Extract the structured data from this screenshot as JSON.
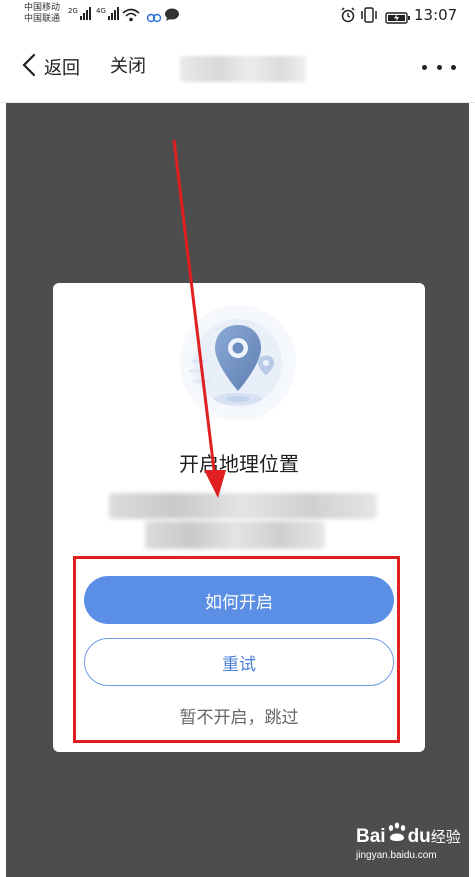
{
  "status_bar": {
    "carrier_1": "中国移动",
    "carrier_2": "中国联通",
    "network_1": "2G",
    "network_2": "4G",
    "time": "13:07",
    "icons": [
      "signal-icon",
      "wifi-icon",
      "cloud-icon",
      "chat-bubble-icon",
      "alarm-icon",
      "vibrate-icon",
      "battery-icon"
    ]
  },
  "nav": {
    "back_label": "返回",
    "close_label": "关闭",
    "more_icon": "more-dots-icon"
  },
  "dialog": {
    "illustration_icon": "location-pin-icon",
    "title": "开启地理位置",
    "primary_button": "如何开启",
    "secondary_button": "重试",
    "skip_link": "暂不开启，跳过"
  },
  "colors": {
    "primary": "#5b8ee5",
    "overlay": "#4d4d4d",
    "annotation": "#e02020"
  },
  "watermark": {
    "logo": "Bai",
    "logo_suffix": "du",
    "label": "经验",
    "url": "jingyan.baidu.com"
  }
}
